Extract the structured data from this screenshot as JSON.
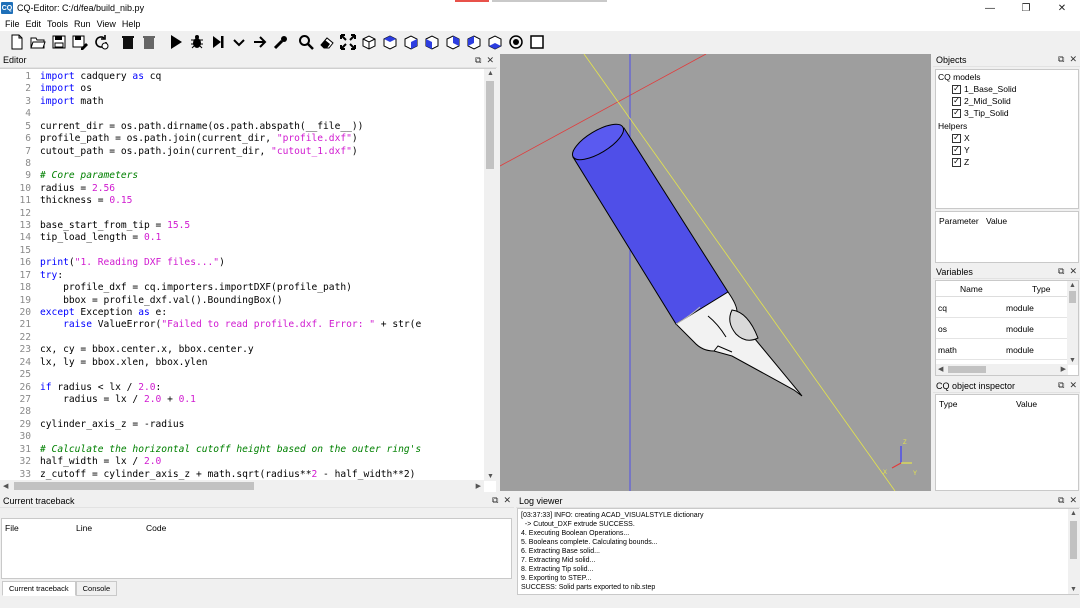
{
  "window": {
    "title": "CQ-Editor: C:/d/fea/build_nib.py",
    "logo": "CQ"
  },
  "menu": [
    "File",
    "Edit",
    "Tools",
    "Run",
    "View",
    "Help"
  ],
  "toolbar_icons": [
    "new-file-icon",
    "open-file-icon",
    "save-icon",
    "save-as-icon",
    "reload-icon",
    "delete-icon",
    "delete-all-icon",
    "run-icon",
    "debug-icon",
    "step-icon",
    "step-in-icon",
    "continue-icon",
    "screenshot-icon",
    "fit-icon",
    "clear-icon",
    "fullscreen-icon",
    "iso-view-icon",
    "top-view-icon",
    "bottom-view-icon",
    "front-view-icon",
    "back-view-icon",
    "left-view-icon",
    "right-view-icon",
    "wireframe-icon",
    "shaded-icon"
  ],
  "editor": {
    "title": "Editor",
    "lines": [
      [
        [
          "kw",
          "import"
        ],
        [
          "t",
          " cadquery "
        ],
        [
          "kw",
          "as"
        ],
        [
          "t",
          " cq"
        ]
      ],
      [
        [
          "kw",
          "import"
        ],
        [
          "t",
          " os"
        ]
      ],
      [
        [
          "kw",
          "import"
        ],
        [
          "t",
          " math"
        ]
      ],
      [],
      [
        [
          "t",
          "current_dir = os.path.dirname(os.path.abspath(__file__))"
        ]
      ],
      [
        [
          "t",
          "profile_path = os.path.join(current_dir, "
        ],
        [
          "str",
          "\"profile.dxf\""
        ],
        [
          "t",
          ")"
        ]
      ],
      [
        [
          "t",
          "cutout_path = os.path.join(current_dir, "
        ],
        [
          "str",
          "\"cutout_1.dxf\""
        ],
        [
          "t",
          ")"
        ]
      ],
      [],
      [
        [
          "cm",
          "# Core parameters"
        ]
      ],
      [
        [
          "t",
          "radius = "
        ],
        [
          "num",
          "2.56"
        ]
      ],
      [
        [
          "t",
          "thickness = "
        ],
        [
          "num",
          "0.15"
        ]
      ],
      [],
      [
        [
          "t",
          "base_start_from_tip = "
        ],
        [
          "num",
          "15.5"
        ]
      ],
      [
        [
          "t",
          "tip_load_length = "
        ],
        [
          "num",
          "0.1"
        ]
      ],
      [],
      [
        [
          "kw",
          "print"
        ],
        [
          "t",
          "("
        ],
        [
          "str",
          "\"1. Reading DXF files...\""
        ],
        [
          "t",
          ")"
        ]
      ],
      [
        [
          "kw",
          "try"
        ],
        [
          "t",
          ":"
        ]
      ],
      [
        [
          "t",
          "    profile_dxf = cq.importers.importDXF(profile_path)"
        ]
      ],
      [
        [
          "t",
          "    bbox = profile_dxf.val().BoundingBox()"
        ]
      ],
      [
        [
          "kw",
          "except"
        ],
        [
          "t",
          " Exception "
        ],
        [
          "kw",
          "as"
        ],
        [
          "t",
          " e:"
        ]
      ],
      [
        [
          "t",
          "    "
        ],
        [
          "kw",
          "raise"
        ],
        [
          "t",
          " ValueError("
        ],
        [
          "str",
          "\"Failed to read profile.dxf. Error: \""
        ],
        [
          "t",
          " + str(e"
        ]
      ],
      [],
      [
        [
          "t",
          "cx, cy = bbox.center.x, bbox.center.y"
        ]
      ],
      [
        [
          "t",
          "lx, ly = bbox.xlen, bbox.ylen"
        ]
      ],
      [],
      [
        [
          "kw",
          "if"
        ],
        [
          "t",
          " radius < lx / "
        ],
        [
          "num",
          "2.0"
        ],
        [
          "t",
          ":"
        ]
      ],
      [
        [
          "t",
          "    radius = lx / "
        ],
        [
          "num",
          "2.0"
        ],
        [
          "t",
          " + "
        ],
        [
          "num",
          "0.1"
        ]
      ],
      [],
      [
        [
          "t",
          "cylinder_axis_z = -radius"
        ]
      ],
      [],
      [
        [
          "cm",
          "# Calculate the horizontal cutoff height based on the outer ring's"
        ]
      ],
      [
        [
          "t",
          "half_width = lx / "
        ],
        [
          "num",
          "2.0"
        ]
      ],
      [
        [
          "t",
          "z_cutoff = cylinder_axis_z + math.sqrt(radius**"
        ],
        [
          "num",
          "2"
        ],
        [
          "t",
          " - half_width**2)"
        ]
      ]
    ]
  },
  "objects": {
    "title": "Objects",
    "group1": "CQ models",
    "models": [
      "1_Base_Solid",
      "2_Mid_Solid",
      "3_Tip_Solid"
    ],
    "group2": "Helpers",
    "helpers": [
      "X",
      "Y",
      "Z"
    ]
  },
  "parameter_panel": {
    "col1": "Parameter",
    "col2": "Value"
  },
  "variables": {
    "title": "Variables",
    "col_name": "Name",
    "col_type": "Type",
    "rows": [
      [
        "cq",
        "module"
      ],
      [
        "os",
        "module"
      ],
      [
        "math",
        "module"
      ]
    ]
  },
  "inspector": {
    "title": "CQ object inspector",
    "col1": "Type",
    "col2": "Value"
  },
  "traceback": {
    "title": "Current traceback",
    "cols": [
      "File",
      "Line",
      "Code"
    ],
    "tabs": [
      "Current traceback",
      "Console"
    ]
  },
  "log": {
    "title": "Log viewer",
    "lines": [
      "[03:37:33] INFO: creating ACAD_VISUALSTYLE dictionary",
      "  -> Cutout_DXF extrude SUCCESS.",
      "4. Executing Boolean Operations...",
      "5. Booleans complete. Calculating bounds...",
      "6. Extracting Base solid...",
      "7. Extracting Mid solid...",
      "8. Extracting Tip solid...",
      "9. Exporting to STEP...",
      "SUCCESS: Solid parts exported to nib.step"
    ]
  },
  "axis_triad": {
    "x": "X",
    "y": "Y",
    "z": "Z"
  },
  "colors": {
    "viewport_bg": "#9e9e9e",
    "barrel": "#4f4fe8",
    "nib": "#f2f2f2",
    "editor_bg": "#ffffff"
  }
}
